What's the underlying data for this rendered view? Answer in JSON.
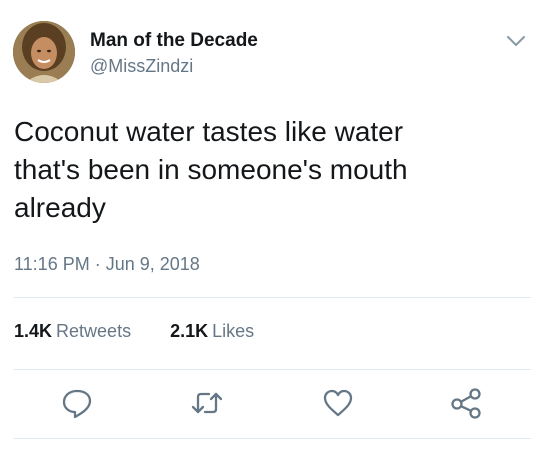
{
  "author": {
    "display_name": "Man of the Decade",
    "handle": "@MissZindzi"
  },
  "tweet": {
    "text": "Coconut water tastes like water\nthat's been in someone's mouth\nalready",
    "timestamp": "11:16 PM · Jun 9, 2018"
  },
  "stats": {
    "retweets_count": "1.4K",
    "retweets_label": "Retweets",
    "likes_count": "2.1K",
    "likes_label": "Likes"
  },
  "icons": {
    "menu": "chevron-down-icon",
    "reply": "reply-icon",
    "retweet": "retweet-icon",
    "like": "heart-icon",
    "share": "share-icon"
  },
  "colors": {
    "text_primary": "#14171a",
    "text_secondary": "#657786",
    "divider": "#e1e8ed"
  }
}
